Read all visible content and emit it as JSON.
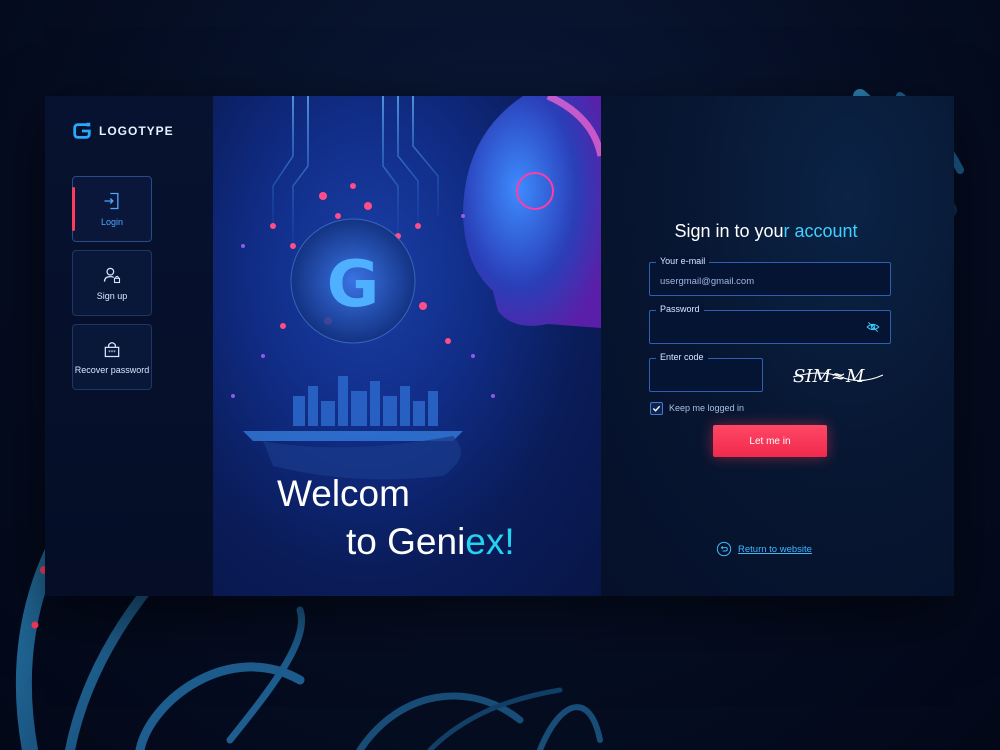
{
  "brand": {
    "logo_text": "LOGOTYPE",
    "hero_logo_letter": "G"
  },
  "sidebar": {
    "items": [
      {
        "label": "Login",
        "icon": "login-door-icon",
        "active": true
      },
      {
        "label": "Sign up",
        "icon": "user-lock-icon",
        "active": false
      },
      {
        "label": "Recover password",
        "icon": "password-lock-icon",
        "active": false
      }
    ]
  },
  "hero": {
    "title_line1": "Welcom",
    "title_line2_main": "to Geni",
    "title_line2_accent": "ex!"
  },
  "form": {
    "title_main": "Sign in to you",
    "title_accent": "r account",
    "email_label": "Your e-mail",
    "email_value": "usergmail@gmail.com",
    "password_label": "Password",
    "password_value": "",
    "code_label": "Enter code",
    "code_value": "",
    "captcha_text": "SIM≈M",
    "keep_logged_label": "Keep me logged in",
    "keep_logged_checked": true,
    "submit_label": "Let me in",
    "return_label": "Return to website"
  },
  "colors": {
    "accent_cyan": "#22d4f0",
    "accent_red": "#ff3b5c",
    "field_border": "#2f5fb0"
  }
}
